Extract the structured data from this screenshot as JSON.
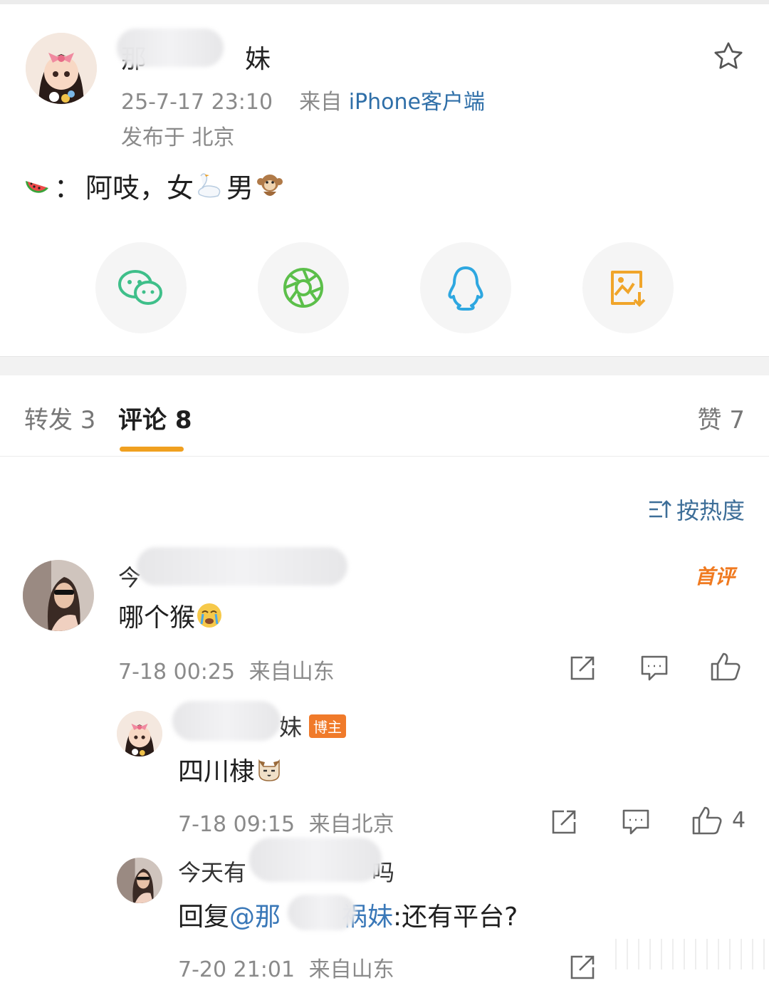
{
  "post": {
    "author_name_visible_start": "那",
    "author_name_visible_end": "妹",
    "time": "25-7-17 23:10",
    "source_prefix": "来自",
    "source": "iPhone客户端",
    "location": "发布于 北京",
    "content_prefix": "：",
    "content": "阿吱，女",
    "content_mid": "男"
  },
  "tabs": [
    {
      "label": "转发 3"
    },
    {
      "label": "评论 8"
    },
    {
      "label": "赞 7"
    }
  ],
  "sort_label": "按热度",
  "comments": [
    {
      "name_visible": "今",
      "first_badge": "首评",
      "text": "哪个猴",
      "time": "7-18 00:25",
      "location": "来自山东"
    },
    {
      "name_visible": "妹",
      "badge": "博主",
      "text": "四川棣",
      "time": "7-18 09:15",
      "location": "来自北京",
      "likes": "4"
    },
    {
      "name_visible": "今天有",
      "name_visible_end": "吗",
      "reply_prefix": "回复",
      "reply_mention": "@那",
      "reply_mention_end": "祸妹",
      "reply_text": ":还有平台?",
      "time": "7-20 21:01",
      "location": "来自山东"
    }
  ]
}
